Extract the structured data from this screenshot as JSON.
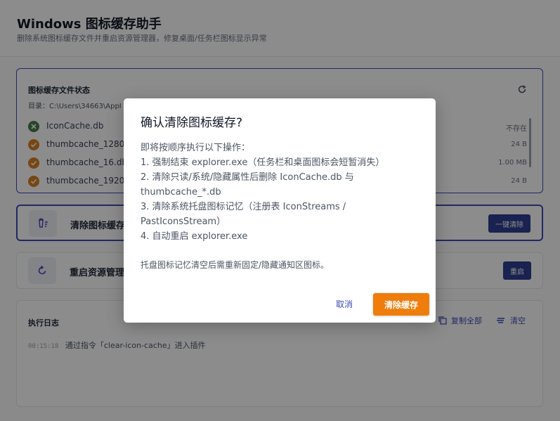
{
  "header": {
    "title": "Windows 图标缓存助手",
    "subtitle": "删除系统图标缓存文件并重启资源管理器，修复桌面/任务栏图标显示异常"
  },
  "status": {
    "title": "图标缓存文件状态",
    "path_label": "目录：C:\\Users\\34663\\AppI",
    "files": [
      {
        "name": "IconCache.db",
        "size": "不存在",
        "state": "missing"
      },
      {
        "name": "thumbcache_1280.",
        "size": "24 B",
        "state": "exists"
      },
      {
        "name": "thumbcache_16.db",
        "size": "1.00 MB",
        "state": "exists"
      },
      {
        "name": "thumbcache_1920.",
        "size": "24 B",
        "state": "exists"
      }
    ]
  },
  "actions": {
    "clean_label": "清除图标缓存",
    "clean_button": "一键清除",
    "restart_label": "重启资源管理",
    "restart_button": "重启"
  },
  "log": {
    "title": "执行日志",
    "copy_label": "复制全部",
    "clear_label": "清空",
    "entries": [
      {
        "time": "00:15:18",
        "text": "通过指令「clear-icon-cache」进入插件"
      }
    ]
  },
  "dialog": {
    "title": "确认清除图标缓存?",
    "lines": [
      "即将按顺序执行以下操作：",
      "1. 强制结束 explorer.exe（任务栏和桌面图标会短暂消失）",
      "2. 清除只读/系统/隐藏属性后删除 IconCache.db 与",
      "thumbcache_*.db",
      "3. 清除系统托盘图标记忆（注册表 IconStreams /",
      "PastIconsStream）",
      "4. 自动重启 explorer.exe"
    ],
    "note": "托盘图标记忆清空后需重新固定/隐藏通知区图标。",
    "cancel": "取消",
    "confirm": "清除缓存"
  },
  "colors": {
    "accent": "#2f3f93",
    "primary_action": "#ef7d0b",
    "ok_icon": "#4a7a4a",
    "warn_icon": "#d98223"
  }
}
